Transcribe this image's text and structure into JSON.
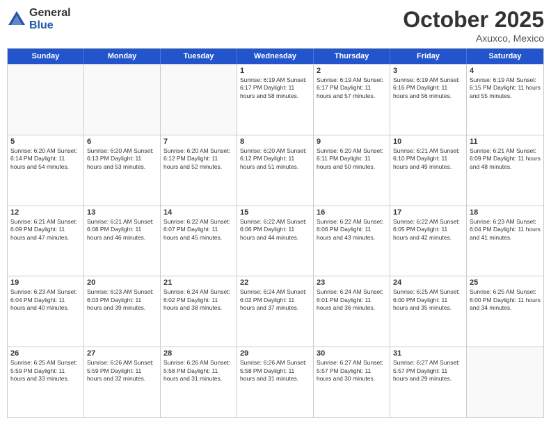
{
  "logo": {
    "general": "General",
    "blue": "Blue"
  },
  "title": "October 2025",
  "location": "Axuxco, Mexico",
  "days_of_week": [
    "Sunday",
    "Monday",
    "Tuesday",
    "Wednesday",
    "Thursday",
    "Friday",
    "Saturday"
  ],
  "weeks": [
    [
      {
        "day": "",
        "info": ""
      },
      {
        "day": "",
        "info": ""
      },
      {
        "day": "",
        "info": ""
      },
      {
        "day": "1",
        "info": "Sunrise: 6:19 AM\nSunset: 6:17 PM\nDaylight: 11 hours and 58 minutes."
      },
      {
        "day": "2",
        "info": "Sunrise: 6:19 AM\nSunset: 6:17 PM\nDaylight: 11 hours and 57 minutes."
      },
      {
        "day": "3",
        "info": "Sunrise: 6:19 AM\nSunset: 6:16 PM\nDaylight: 11 hours and 56 minutes."
      },
      {
        "day": "4",
        "info": "Sunrise: 6:19 AM\nSunset: 6:15 PM\nDaylight: 11 hours and 55 minutes."
      }
    ],
    [
      {
        "day": "5",
        "info": "Sunrise: 6:20 AM\nSunset: 6:14 PM\nDaylight: 11 hours and 54 minutes."
      },
      {
        "day": "6",
        "info": "Sunrise: 6:20 AM\nSunset: 6:13 PM\nDaylight: 11 hours and 53 minutes."
      },
      {
        "day": "7",
        "info": "Sunrise: 6:20 AM\nSunset: 6:12 PM\nDaylight: 11 hours and 52 minutes."
      },
      {
        "day": "8",
        "info": "Sunrise: 6:20 AM\nSunset: 6:12 PM\nDaylight: 11 hours and 51 minutes."
      },
      {
        "day": "9",
        "info": "Sunrise: 6:20 AM\nSunset: 6:11 PM\nDaylight: 11 hours and 50 minutes."
      },
      {
        "day": "10",
        "info": "Sunrise: 6:21 AM\nSunset: 6:10 PM\nDaylight: 11 hours and 49 minutes."
      },
      {
        "day": "11",
        "info": "Sunrise: 6:21 AM\nSunset: 6:09 PM\nDaylight: 11 hours and 48 minutes."
      }
    ],
    [
      {
        "day": "12",
        "info": "Sunrise: 6:21 AM\nSunset: 6:09 PM\nDaylight: 11 hours and 47 minutes."
      },
      {
        "day": "13",
        "info": "Sunrise: 6:21 AM\nSunset: 6:08 PM\nDaylight: 11 hours and 46 minutes."
      },
      {
        "day": "14",
        "info": "Sunrise: 6:22 AM\nSunset: 6:07 PM\nDaylight: 11 hours and 45 minutes."
      },
      {
        "day": "15",
        "info": "Sunrise: 6:22 AM\nSunset: 6:06 PM\nDaylight: 11 hours and 44 minutes."
      },
      {
        "day": "16",
        "info": "Sunrise: 6:22 AM\nSunset: 6:06 PM\nDaylight: 11 hours and 43 minutes."
      },
      {
        "day": "17",
        "info": "Sunrise: 6:22 AM\nSunset: 6:05 PM\nDaylight: 11 hours and 42 minutes."
      },
      {
        "day": "18",
        "info": "Sunrise: 6:23 AM\nSunset: 6:04 PM\nDaylight: 11 hours and 41 minutes."
      }
    ],
    [
      {
        "day": "19",
        "info": "Sunrise: 6:23 AM\nSunset: 6:04 PM\nDaylight: 11 hours and 40 minutes."
      },
      {
        "day": "20",
        "info": "Sunrise: 6:23 AM\nSunset: 6:03 PM\nDaylight: 11 hours and 39 minutes."
      },
      {
        "day": "21",
        "info": "Sunrise: 6:24 AM\nSunset: 6:02 PM\nDaylight: 11 hours and 38 minutes."
      },
      {
        "day": "22",
        "info": "Sunrise: 6:24 AM\nSunset: 6:02 PM\nDaylight: 11 hours and 37 minutes."
      },
      {
        "day": "23",
        "info": "Sunrise: 6:24 AM\nSunset: 6:01 PM\nDaylight: 11 hours and 36 minutes."
      },
      {
        "day": "24",
        "info": "Sunrise: 6:25 AM\nSunset: 6:00 PM\nDaylight: 11 hours and 35 minutes."
      },
      {
        "day": "25",
        "info": "Sunrise: 6:25 AM\nSunset: 6:00 PM\nDaylight: 11 hours and 34 minutes."
      }
    ],
    [
      {
        "day": "26",
        "info": "Sunrise: 6:25 AM\nSunset: 5:59 PM\nDaylight: 11 hours and 33 minutes."
      },
      {
        "day": "27",
        "info": "Sunrise: 6:26 AM\nSunset: 5:59 PM\nDaylight: 11 hours and 32 minutes."
      },
      {
        "day": "28",
        "info": "Sunrise: 6:26 AM\nSunset: 5:58 PM\nDaylight: 11 hours and 31 minutes."
      },
      {
        "day": "29",
        "info": "Sunrise: 6:26 AM\nSunset: 5:58 PM\nDaylight: 11 hours and 31 minutes."
      },
      {
        "day": "30",
        "info": "Sunrise: 6:27 AM\nSunset: 5:57 PM\nDaylight: 11 hours and 30 minutes."
      },
      {
        "day": "31",
        "info": "Sunrise: 6:27 AM\nSunset: 5:57 PM\nDaylight: 11 hours and 29 minutes."
      },
      {
        "day": "",
        "info": ""
      }
    ]
  ]
}
